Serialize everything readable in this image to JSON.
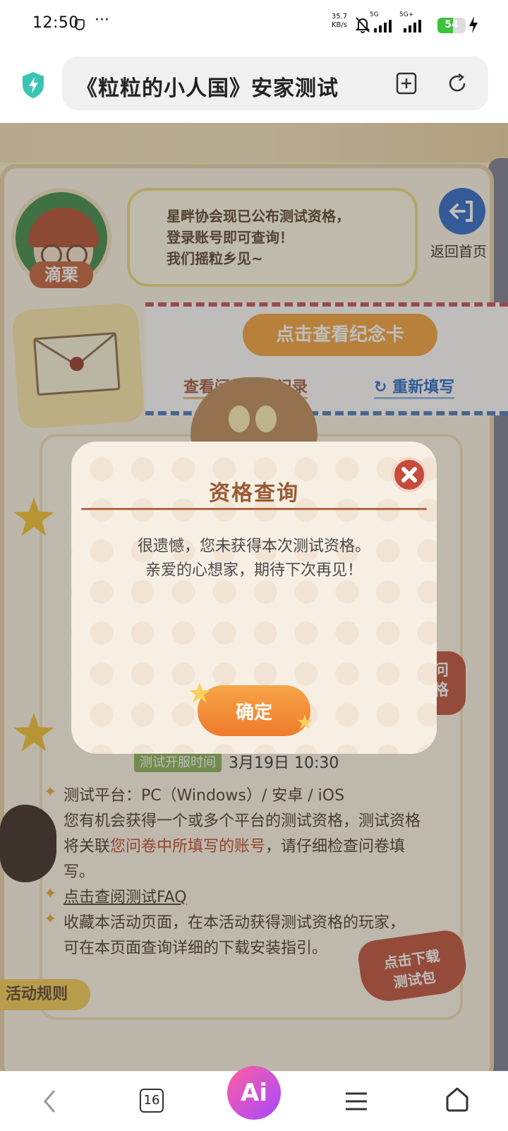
{
  "status_bar": {
    "time": "12:50",
    "more": "···",
    "net_speed": "35.7",
    "net_unit": "KB/s",
    "sim1": "5G",
    "sim2": "5G+",
    "battery": "54",
    "battery_level": 0.54
  },
  "browser": {
    "url_title": "《粒粒的小人国》安家测试",
    "security_icon": "shield-bolt-icon",
    "add_tab_icon": "add-tab-icon",
    "refresh_icon": "refresh-icon"
  },
  "page": {
    "avatar_name": "滴栗",
    "speech_lines": [
      "星畔协会现已公布测试资格，",
      "登录账号即可查询！",
      "我们摇粒乡见~"
    ],
    "back_home": "返回首页",
    "memorial_button": "点击查看纪念卡",
    "record_link": "查看问卷填写记录",
    "refill_link": "重新填写",
    "schedule_badge": "测试开服时间",
    "schedule_value": "3月19日  10:30",
    "rules": {
      "platform": "测试平台：PC（Windows）/ 安卓 / iOS",
      "line2": "您有机会获得一个或多个平台的测试资格，测试资格",
      "line3_a": "将关联",
      "line3_hl": "您问卷中所填写的账号",
      "line3_b": "，请仔细检查问卷填",
      "line4": "写。",
      "faq_link": "点击查阅测试FAQ",
      "line6": "收藏本活动页面，在本活动获得测试资格的玩家，",
      "line7": "可在本页面查询详细的下载安装指引。"
    },
    "download_btn_line1": "点击下载",
    "download_btn_line2": "测试包",
    "side_btn_line1": "问",
    "side_btn_line2": "格",
    "activity_rules": "活动规则"
  },
  "modal": {
    "title": "资格查询",
    "message_line1": "很遗憾，您未获得本次测试资格。",
    "message_line2": "亲爱的心想家，期待下次再见！",
    "confirm": "确定",
    "close_icon": "close-x-icon"
  },
  "bottom_nav": {
    "tab_count": "16",
    "ai_label": "Ai"
  },
  "colors": {
    "accent_orange": "#ee7b2c",
    "modal_title": "#9a5a34",
    "close_red": "#c74a3a",
    "link_blue": "#2c68c8"
  }
}
